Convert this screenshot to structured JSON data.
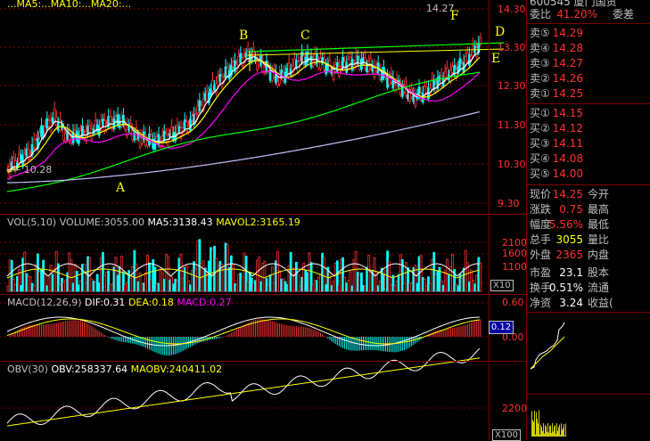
{
  "top_header": {
    "text": "...MA5:...MA10:...MA20:..."
  },
  "price_axis": [
    "14.30",
    "13.30",
    "12.30",
    "11.30",
    "10.30",
    "9.30"
  ],
  "annotations": {
    "a": "A",
    "b": "B",
    "c": "C",
    "d": "D",
    "e": "E",
    "f": "F",
    "high": "14.27",
    "low": "10.28"
  },
  "vol": {
    "title": "VOL(5,10)",
    "volume": "VOLUME:3055.00",
    "ma5": "MA5:3138.43",
    "mavol2": "MAVOL2:3165.19",
    "axis": [
      "2100",
      "1600",
      "1100"
    ],
    "unit": "X10"
  },
  "macd": {
    "title": "MACD(12,26,9)",
    "dif": "DIF:0.31",
    "dea": "DEA:0.18",
    "macd": "MACD:0.27",
    "axis": [
      "0.60",
      "0.00"
    ],
    "box": "0.12"
  },
  "obv": {
    "title": "OBV(30)",
    "obv": "OBV:258337.64",
    "maobv": "MAOBV:240411.02",
    "axis": [
      "2200"
    ],
    "unit": "X100"
  },
  "right_panel": {
    "title_code": "600545 厦门国贸",
    "weibi_label": "委比",
    "weibi_value": "41.20%",
    "weicha_label": "委差",
    "sell": [
      {
        "label": "卖⑤",
        "price": "14.29"
      },
      {
        "label": "卖④",
        "price": "14.28"
      },
      {
        "label": "卖③",
        "price": "14.27"
      },
      {
        "label": "卖②",
        "price": "14.26"
      },
      {
        "label": "卖①",
        "price": "14.25"
      }
    ],
    "buy": [
      {
        "label": "买①",
        "price": "14.15"
      },
      {
        "label": "买②",
        "price": "14.12"
      },
      {
        "label": "买③",
        "price": "14.11"
      },
      {
        "label": "买④",
        "price": "14.08"
      },
      {
        "label": "买⑤",
        "price": "14.00"
      }
    ],
    "stats": [
      {
        "l": "现价",
        "v": "14.25",
        "l2": "今开",
        "c": "red"
      },
      {
        "l": "涨跌",
        "v": "0.75",
        "l2": "最高",
        "c": "red"
      },
      {
        "l": "幅度",
        "v": "5.56%",
        "l2": "最低",
        "c": "red"
      },
      {
        "l": "总手",
        "v": "3055",
        "l2": "量比",
        "c": "yel"
      },
      {
        "l": "外盘",
        "v": "2365",
        "l2": "内盘",
        "c": "red"
      },
      {
        "l": "市盈",
        "v": "23.1",
        "l2": "股本",
        "c": "white"
      },
      {
        "l": "换手",
        "v": "0.51%",
        "l2": "流通",
        "c": "white"
      },
      {
        "l": "净资",
        "v": "3.24",
        "l2": "收益(",
        "c": "white"
      }
    ]
  },
  "colors": {
    "up": "#ff3030",
    "down": "#00ffff",
    "ma5": "#ffffff",
    "ma10": "#ffff00",
    "ma20": "#ff00ff",
    "ma60": "#00ff00",
    "ma120": "#c0c0ff",
    "trend": "#00ff00"
  }
}
